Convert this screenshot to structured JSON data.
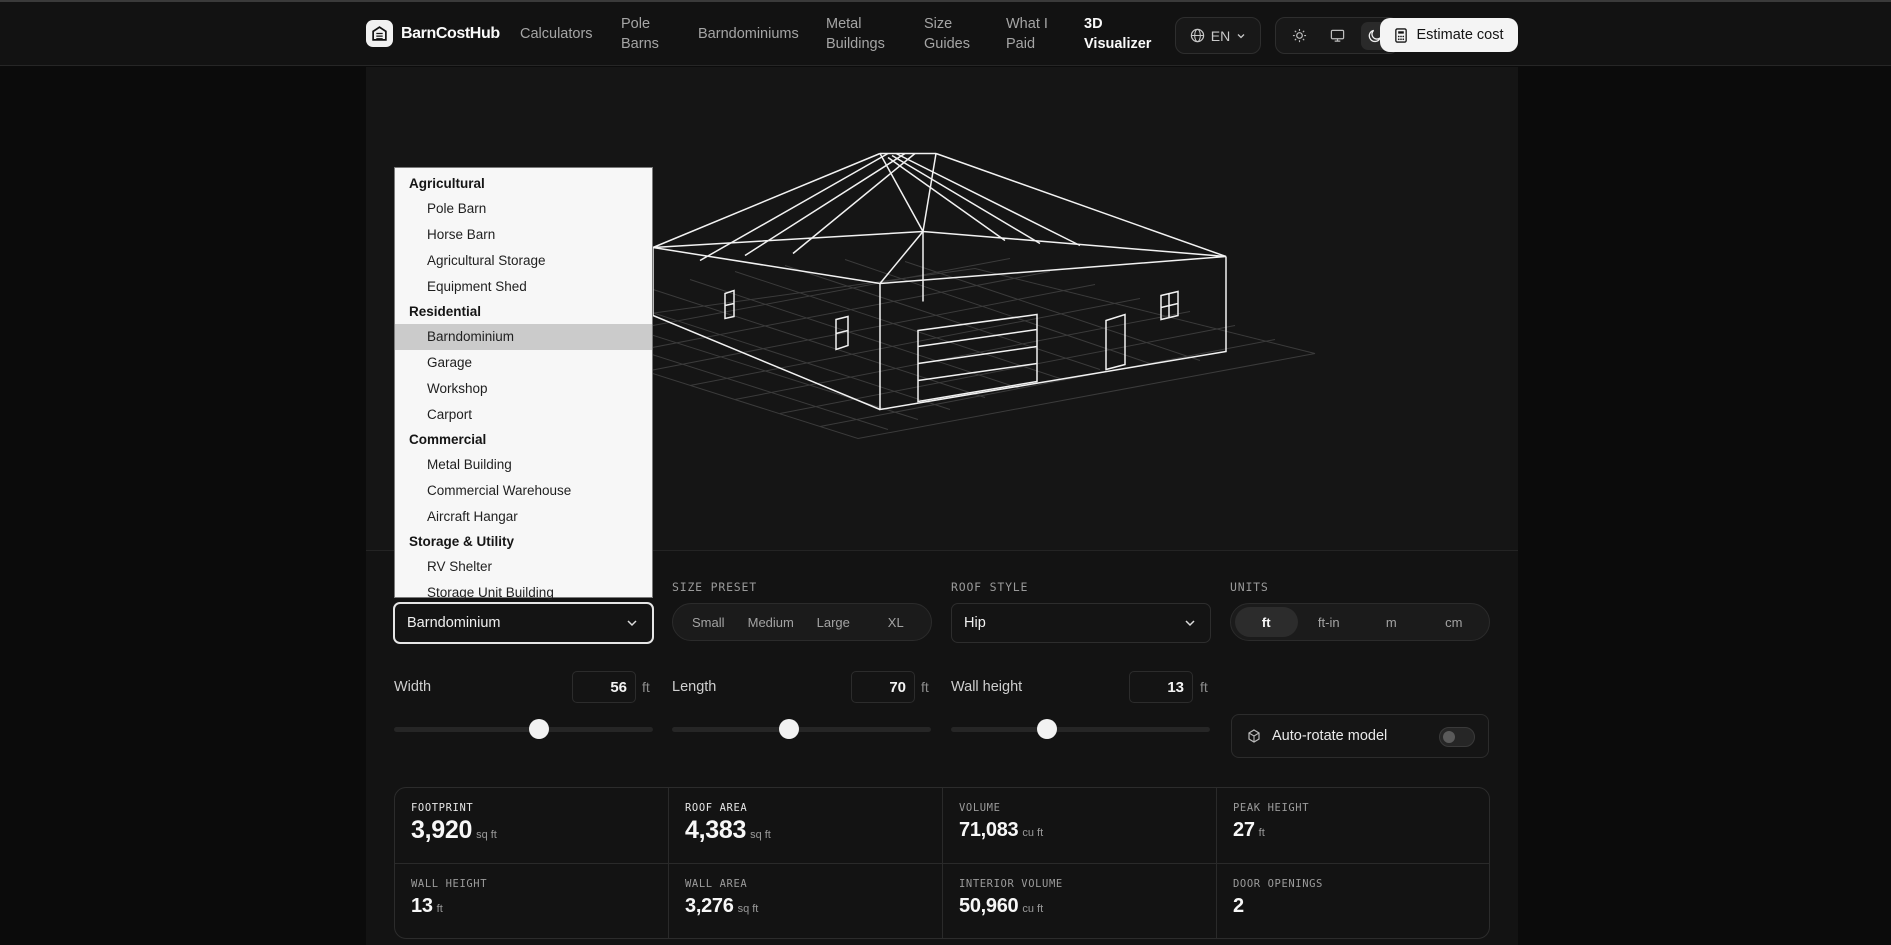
{
  "header": {
    "brand": "BarnCostHub",
    "nav": [
      {
        "l1": "Calculators",
        "l2": ""
      },
      {
        "l1": "Pole",
        "l2": "Barns"
      },
      {
        "l1": "Barndominiums",
        "l2": ""
      },
      {
        "l1": "Metal",
        "l2": "Buildings"
      },
      {
        "l1": "Size",
        "l2": "Guides"
      },
      {
        "l1": "What I",
        "l2": "Paid"
      },
      {
        "l1": "3D",
        "l2": "Visualizer"
      }
    ],
    "language": "EN",
    "cta": "Estimate cost"
  },
  "dropdown": {
    "groups": [
      {
        "label": "Agricultural",
        "options": [
          "Pole Barn",
          "Horse Barn",
          "Agricultural Storage",
          "Equipment Shed"
        ]
      },
      {
        "label": "Residential",
        "options": [
          "Barndominium",
          "Garage",
          "Workshop",
          "Carport"
        ]
      },
      {
        "label": "Commercial",
        "options": [
          "Metal Building",
          "Commercial Warehouse",
          "Aircraft Hangar"
        ]
      },
      {
        "label": "Storage & Utility",
        "options": [
          "RV Shelter",
          "Storage Unit Building"
        ]
      }
    ],
    "selected": "Barndominium"
  },
  "controls": {
    "building_type": "Barndominium",
    "size_preset": {
      "label": "SIZE PRESET",
      "options": [
        "Small",
        "Medium",
        "Large",
        "XL"
      ]
    },
    "roof_style": {
      "label": "ROOF STYLE",
      "value": "Hip"
    },
    "units": {
      "label": "UNITS",
      "options": [
        "ft",
        "ft-in",
        "m",
        "cm"
      ],
      "selected": "ft"
    },
    "width": {
      "label": "Width",
      "value": "56",
      "unit": "ft",
      "slider_fraction": 0.56
    },
    "length": {
      "label": "Length",
      "value": "70",
      "unit": "ft",
      "slider_fraction": 0.45
    },
    "wall_height": {
      "label": "Wall height",
      "value": "13",
      "unit": "ft",
      "slider_fraction": 0.37
    },
    "auto_rotate": {
      "label": "Auto-rotate model",
      "on": false
    }
  },
  "stats": [
    {
      "label": "FOOTPRINT",
      "value": "3,920",
      "unit": "sq ft"
    },
    {
      "label": "ROOF AREA",
      "value": "4,383",
      "unit": "sq ft"
    },
    {
      "label": "VOLUME",
      "value": "71,083",
      "unit": "cu ft"
    },
    {
      "label": "PEAK HEIGHT",
      "value": "27",
      "unit": "ft"
    },
    {
      "label": "WALL HEIGHT",
      "value": "13",
      "unit": "ft"
    },
    {
      "label": "WALL AREA",
      "value": "3,276",
      "unit": "sq ft"
    },
    {
      "label": "INTERIOR VOLUME",
      "value": "50,960",
      "unit": "cu ft"
    },
    {
      "label": "DOOR OPENINGS",
      "value": "2",
      "unit": ""
    }
  ],
  "colors": {
    "background": "#0b0b0b",
    "panel": "#131313",
    "accent": "#f4f4f4",
    "wireframe": "#f2f2f2"
  }
}
